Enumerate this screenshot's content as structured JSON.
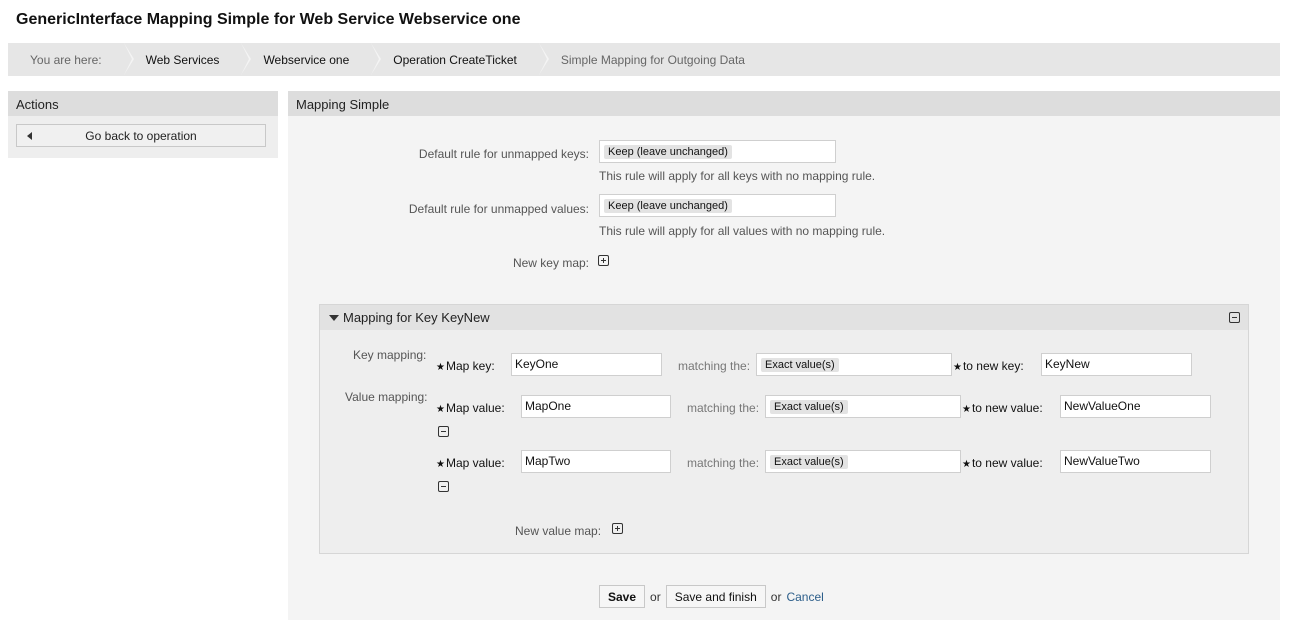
{
  "page_title": "GenericInterface Mapping Simple for Web Service Webservice one",
  "breadcrumb": [
    "You are here:",
    "Web Services",
    "Webservice one",
    "Operation CreateTicket",
    "Simple Mapping for Outgoing Data"
  ],
  "sidebar": {
    "title": "Actions",
    "back_label": "Go back to operation"
  },
  "main": {
    "title": "Mapping Simple",
    "default_keys_label": "Default rule for unmapped keys:",
    "default_keys_value": "Keep (leave unchanged)",
    "default_keys_hint": "This rule will apply for all keys with no mapping rule.",
    "default_values_label": "Default rule for unmapped values:",
    "default_values_value": "Keep (leave unchanged)",
    "default_values_hint": "This rule will apply for all values with no mapping rule.",
    "new_key_map_label": "New key map:"
  },
  "mapping": {
    "title": "Mapping for Key KeyNew",
    "key_mapping_label": "Key mapping:",
    "value_mapping_label": "Value mapping:",
    "map_key_label": "Map key:",
    "map_value_label": "Map value:",
    "matching_label": "matching the:",
    "to_new_key_label": "to new key:",
    "to_new_value_label": "to new value:",
    "key": {
      "map": "KeyOne",
      "match": "Exact value(s)",
      "new": "KeyNew"
    },
    "values": [
      {
        "map": "MapOne",
        "match": "Exact value(s)",
        "new": "NewValueOne"
      },
      {
        "map": "MapTwo",
        "match": "Exact value(s)",
        "new": "NewValueTwo"
      }
    ],
    "new_value_map_label": "New value map:"
  },
  "footer": {
    "save": "Save",
    "or1": "or",
    "save_finish": "Save and finish",
    "or2": "or",
    "cancel": "Cancel"
  }
}
